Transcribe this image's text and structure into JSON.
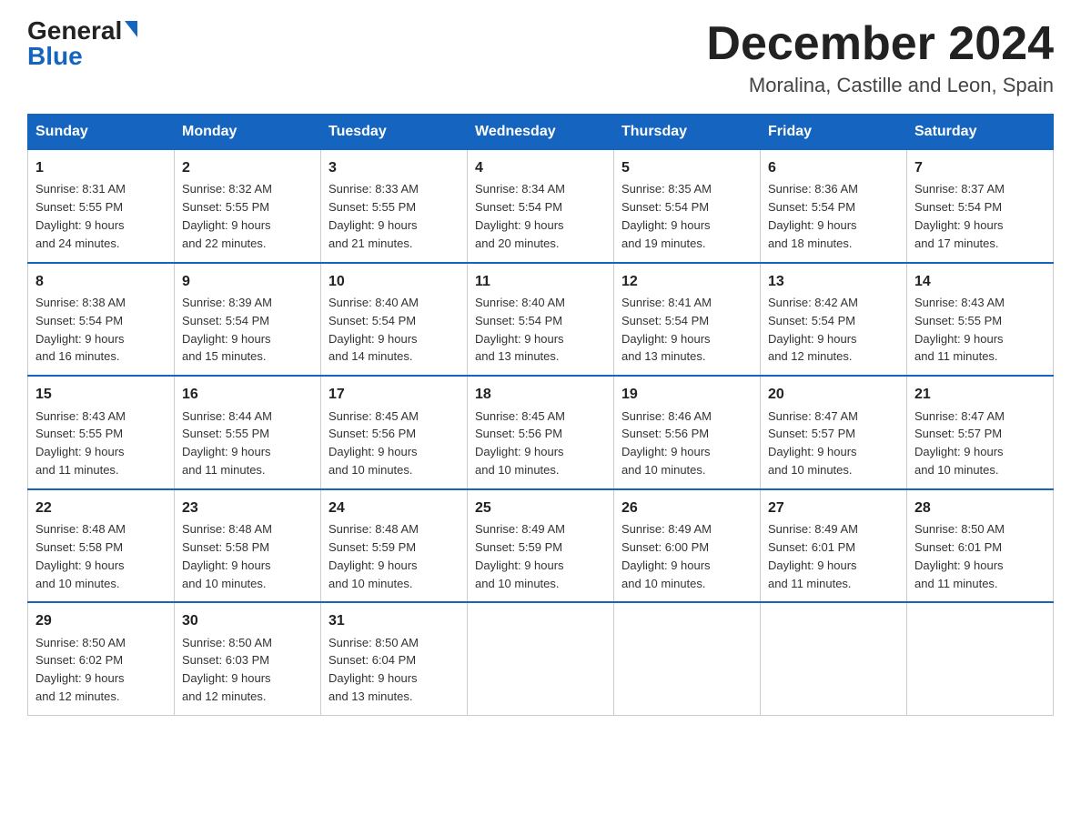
{
  "header": {
    "logo_general": "General",
    "logo_blue": "Blue",
    "title": "December 2024",
    "subtitle": "Moralina, Castille and Leon, Spain"
  },
  "weekdays": [
    "Sunday",
    "Monday",
    "Tuesday",
    "Wednesday",
    "Thursday",
    "Friday",
    "Saturday"
  ],
  "weeks": [
    [
      {
        "day": "1",
        "sunrise": "8:31 AM",
        "sunset": "5:55 PM",
        "daylight": "9 hours and 24 minutes."
      },
      {
        "day": "2",
        "sunrise": "8:32 AM",
        "sunset": "5:55 PM",
        "daylight": "9 hours and 22 minutes."
      },
      {
        "day": "3",
        "sunrise": "8:33 AM",
        "sunset": "5:55 PM",
        "daylight": "9 hours and 21 minutes."
      },
      {
        "day": "4",
        "sunrise": "8:34 AM",
        "sunset": "5:54 PM",
        "daylight": "9 hours and 20 minutes."
      },
      {
        "day": "5",
        "sunrise": "8:35 AM",
        "sunset": "5:54 PM",
        "daylight": "9 hours and 19 minutes."
      },
      {
        "day": "6",
        "sunrise": "8:36 AM",
        "sunset": "5:54 PM",
        "daylight": "9 hours and 18 minutes."
      },
      {
        "day": "7",
        "sunrise": "8:37 AM",
        "sunset": "5:54 PM",
        "daylight": "9 hours and 17 minutes."
      }
    ],
    [
      {
        "day": "8",
        "sunrise": "8:38 AM",
        "sunset": "5:54 PM",
        "daylight": "9 hours and 16 minutes."
      },
      {
        "day": "9",
        "sunrise": "8:39 AM",
        "sunset": "5:54 PM",
        "daylight": "9 hours and 15 minutes."
      },
      {
        "day": "10",
        "sunrise": "8:40 AM",
        "sunset": "5:54 PM",
        "daylight": "9 hours and 14 minutes."
      },
      {
        "day": "11",
        "sunrise": "8:40 AM",
        "sunset": "5:54 PM",
        "daylight": "9 hours and 13 minutes."
      },
      {
        "day": "12",
        "sunrise": "8:41 AM",
        "sunset": "5:54 PM",
        "daylight": "9 hours and 13 minutes."
      },
      {
        "day": "13",
        "sunrise": "8:42 AM",
        "sunset": "5:54 PM",
        "daylight": "9 hours and 12 minutes."
      },
      {
        "day": "14",
        "sunrise": "8:43 AM",
        "sunset": "5:55 PM",
        "daylight": "9 hours and 11 minutes."
      }
    ],
    [
      {
        "day": "15",
        "sunrise": "8:43 AM",
        "sunset": "5:55 PM",
        "daylight": "9 hours and 11 minutes."
      },
      {
        "day": "16",
        "sunrise": "8:44 AM",
        "sunset": "5:55 PM",
        "daylight": "9 hours and 11 minutes."
      },
      {
        "day": "17",
        "sunrise": "8:45 AM",
        "sunset": "5:56 PM",
        "daylight": "9 hours and 10 minutes."
      },
      {
        "day": "18",
        "sunrise": "8:45 AM",
        "sunset": "5:56 PM",
        "daylight": "9 hours and 10 minutes."
      },
      {
        "day": "19",
        "sunrise": "8:46 AM",
        "sunset": "5:56 PM",
        "daylight": "9 hours and 10 minutes."
      },
      {
        "day": "20",
        "sunrise": "8:47 AM",
        "sunset": "5:57 PM",
        "daylight": "9 hours and 10 minutes."
      },
      {
        "day": "21",
        "sunrise": "8:47 AM",
        "sunset": "5:57 PM",
        "daylight": "9 hours and 10 minutes."
      }
    ],
    [
      {
        "day": "22",
        "sunrise": "8:48 AM",
        "sunset": "5:58 PM",
        "daylight": "9 hours and 10 minutes."
      },
      {
        "day": "23",
        "sunrise": "8:48 AM",
        "sunset": "5:58 PM",
        "daylight": "9 hours and 10 minutes."
      },
      {
        "day": "24",
        "sunrise": "8:48 AM",
        "sunset": "5:59 PM",
        "daylight": "9 hours and 10 minutes."
      },
      {
        "day": "25",
        "sunrise": "8:49 AM",
        "sunset": "5:59 PM",
        "daylight": "9 hours and 10 minutes."
      },
      {
        "day": "26",
        "sunrise": "8:49 AM",
        "sunset": "6:00 PM",
        "daylight": "9 hours and 10 minutes."
      },
      {
        "day": "27",
        "sunrise": "8:49 AM",
        "sunset": "6:01 PM",
        "daylight": "9 hours and 11 minutes."
      },
      {
        "day": "28",
        "sunrise": "8:50 AM",
        "sunset": "6:01 PM",
        "daylight": "9 hours and 11 minutes."
      }
    ],
    [
      {
        "day": "29",
        "sunrise": "8:50 AM",
        "sunset": "6:02 PM",
        "daylight": "9 hours and 12 minutes."
      },
      {
        "day": "30",
        "sunrise": "8:50 AM",
        "sunset": "6:03 PM",
        "daylight": "9 hours and 12 minutes."
      },
      {
        "day": "31",
        "sunrise": "8:50 AM",
        "sunset": "6:04 PM",
        "daylight": "9 hours and 13 minutes."
      },
      null,
      null,
      null,
      null
    ]
  ],
  "labels": {
    "sunrise": "Sunrise:",
    "sunset": "Sunset:",
    "daylight": "Daylight:"
  }
}
